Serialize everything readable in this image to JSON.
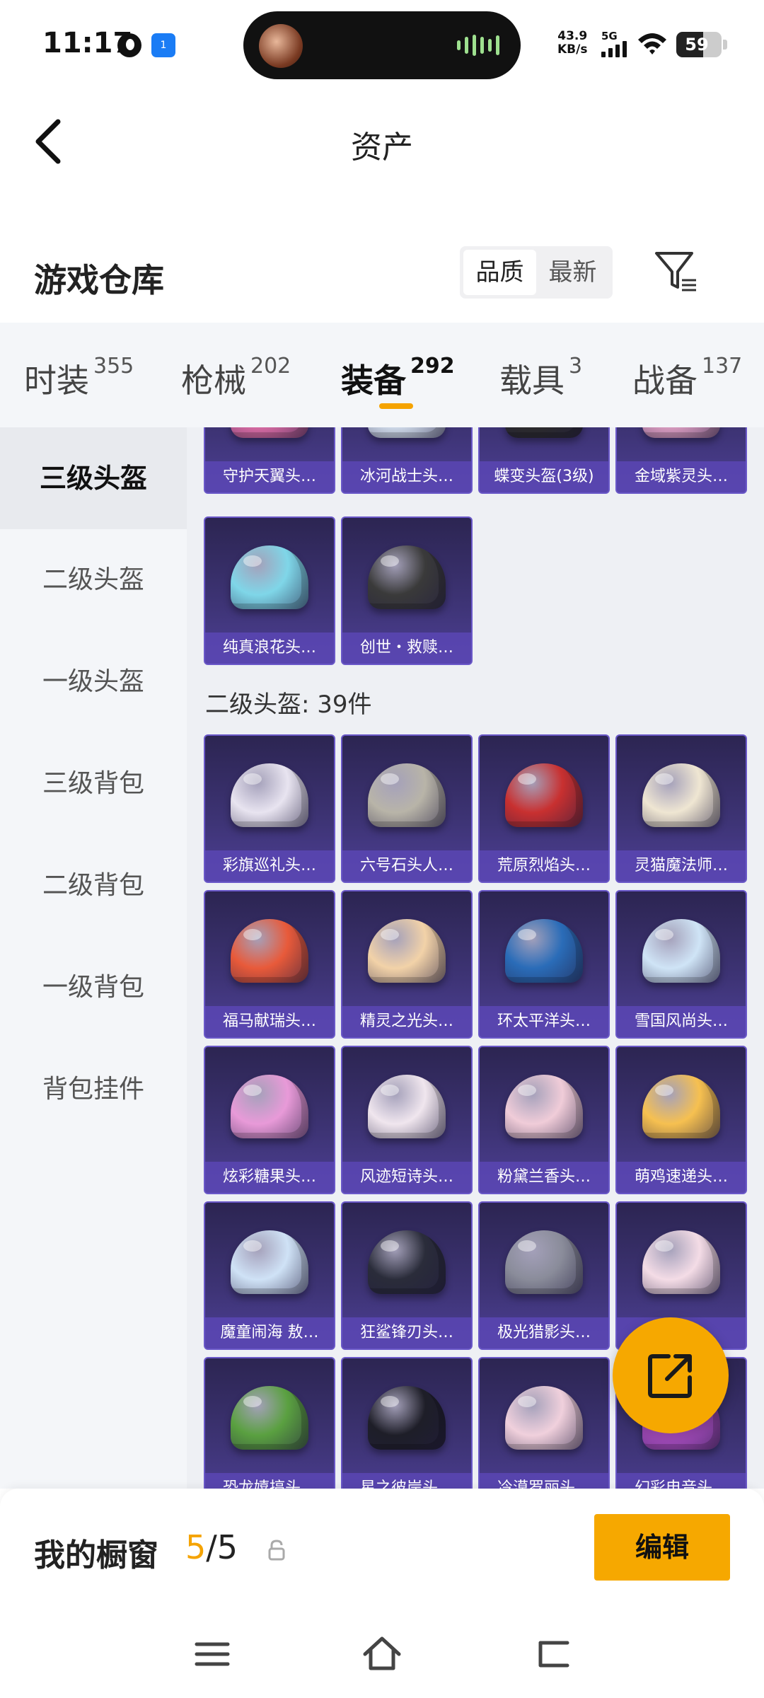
{
  "status_bar": {
    "time": "11:17",
    "net_speed_value": "43.9",
    "net_speed_unit": "KB/s",
    "network": "5G",
    "battery": "59",
    "battery_level": 0.59,
    "notif_badge": "1"
  },
  "header": {
    "title": "资产",
    "back_icon": "chevron-left-icon"
  },
  "warehouse": {
    "title": "游戏仓库",
    "sort_options": [
      "品质",
      "最新"
    ],
    "sort_selected": "品质",
    "filter_icon": "filter-icon"
  },
  "tabs": [
    {
      "label": "时装",
      "count": "355"
    },
    {
      "label": "枪械",
      "count": "202"
    },
    {
      "label": "装备",
      "count": "292",
      "active": true
    },
    {
      "label": "载具",
      "count": "3"
    },
    {
      "label": "战备",
      "count": "137"
    }
  ],
  "sidebar": {
    "items": [
      "三级头盔",
      "二级头盔",
      "一级头盔",
      "三级背包",
      "二级背包",
      "一级背包",
      "背包挂件"
    ],
    "active": "三级头盔"
  },
  "section_level3": {
    "items": [
      {
        "label": "守护天翼头…",
        "color": "#e06fa8"
      },
      {
        "label": "冰河战士头…",
        "color": "#d8e4f2"
      },
      {
        "label": "蝶变头盔(3级)",
        "color": "#2b2b2b"
      },
      {
        "label": "金域紫灵头…",
        "color": "#e2a2c6"
      },
      {
        "label": "纯真浪花头…",
        "color": "#7fd6e8"
      },
      {
        "label": "创世・救赎…",
        "color": "#3a3a3a"
      }
    ]
  },
  "section_level2": {
    "title": "二级头盔: 39件",
    "items": [
      {
        "label": "彩旗巡礼头…",
        "color": "#e8e4f0"
      },
      {
        "label": "六号石头人…",
        "color": "#b8b4a8"
      },
      {
        "label": "荒原烈焰头…",
        "color": "#c83030"
      },
      {
        "label": "灵猫魔法师…",
        "color": "#efe6d2"
      },
      {
        "label": "福马献瑞头…",
        "color": "#e85a3a"
      },
      {
        "label": "精灵之光头…",
        "color": "#f2d2a8"
      },
      {
        "label": "环太平洋头…",
        "color": "#2a6cb8"
      },
      {
        "label": "雪国风尚头…",
        "color": "#cfe4f6"
      },
      {
        "label": "炫彩糖果头…",
        "color": "#e89ad8"
      },
      {
        "label": "风迹短诗头…",
        "color": "#f0e6ee"
      },
      {
        "label": "粉黛兰香头…",
        "color": "#f0ccd8"
      },
      {
        "label": "萌鸡速递头…",
        "color": "#f6c050"
      },
      {
        "label": "魔童闹海 敖…",
        "color": "#cfe2f6"
      },
      {
        "label": "狂鲨锋刃头…",
        "color": "#2a2c3a"
      },
      {
        "label": "极光猎影头…",
        "color": "#8a8c9a"
      },
      {
        "label": "",
        "color": "#f4dce6"
      },
      {
        "label": "恐龙嬉搞头…",
        "color": "#5aa040"
      },
      {
        "label": "星之彼岸头…",
        "color": "#1e1e28"
      },
      {
        "label": "冷漠罗丽头…",
        "color": "#f0d0dc"
      },
      {
        "label": "幻彩电音头…",
        "color": "#b050c8"
      }
    ]
  },
  "fab": {
    "icon": "share-icon"
  },
  "bottom": {
    "window_label": "我的橱窗",
    "window_current": "5",
    "window_total": "/5",
    "edit_label": "编辑"
  },
  "nav": {
    "menu_icon": "menu-icon",
    "home_icon": "home-icon",
    "back_icon": "back-icon"
  }
}
